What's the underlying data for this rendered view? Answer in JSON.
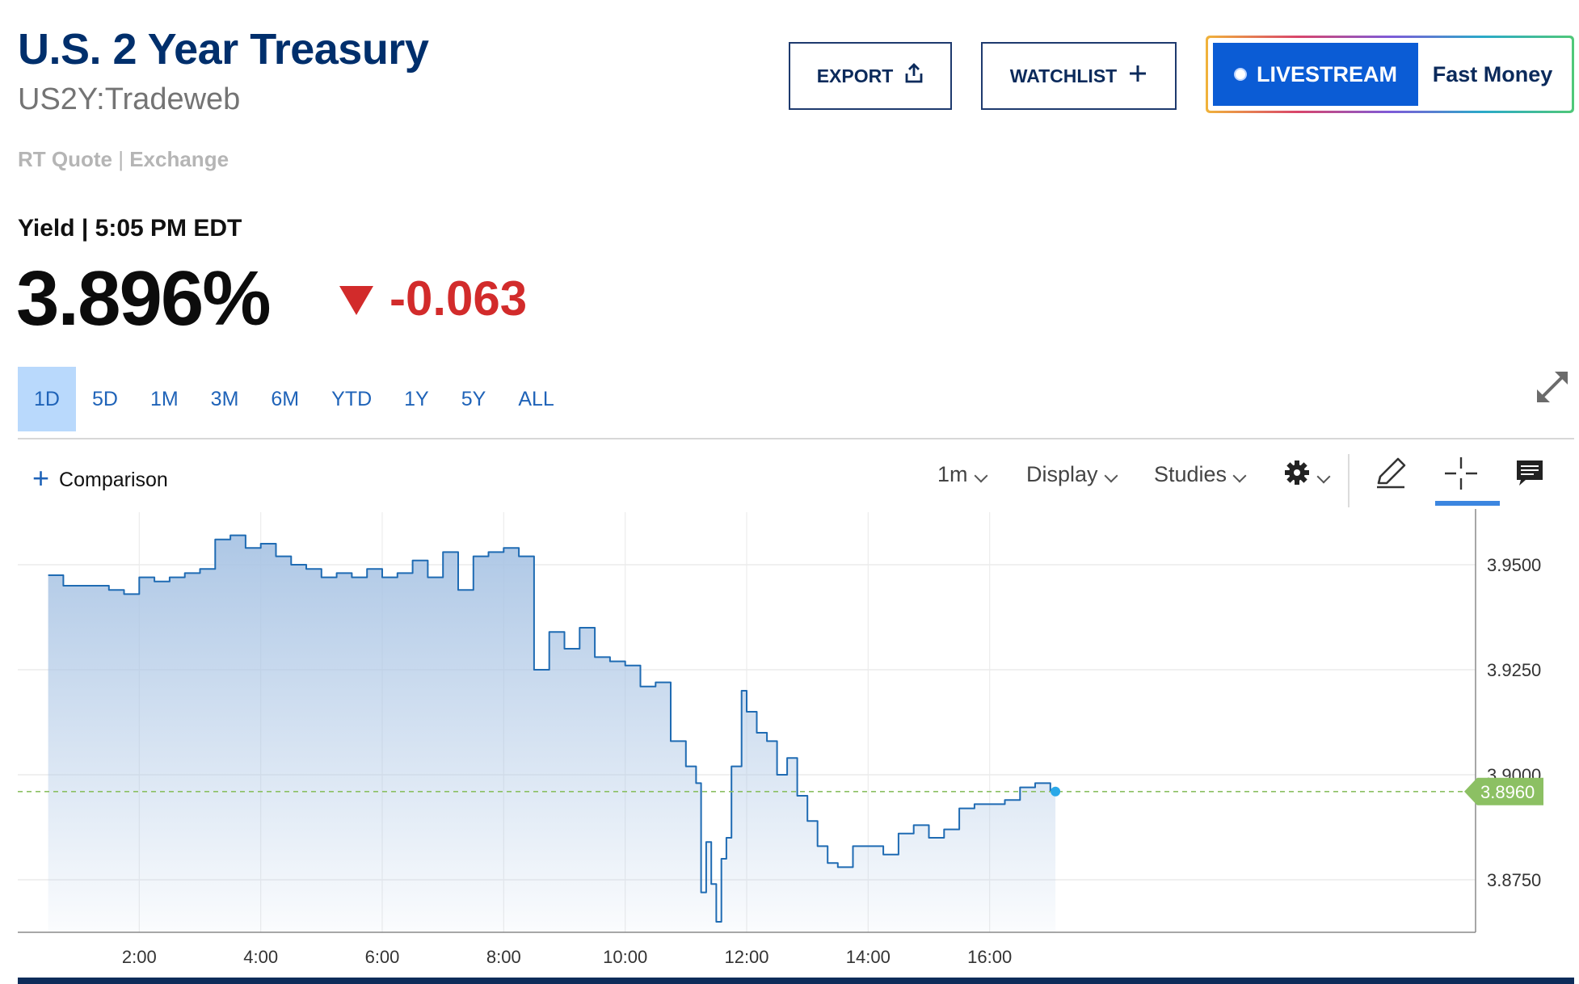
{
  "header": {
    "title": "U.S. 2 Year Treasury",
    "symbol": "US2Y:Tradeweb",
    "quote_type": "RT Quote",
    "quote_sep": " | ",
    "quote_source": "Exchange",
    "yield_label": "Yield | 5:05 PM EDT",
    "price": "3.896%",
    "change": "-0.063",
    "change_direction": "down",
    "change_color": "#d22b2b"
  },
  "buttons": {
    "export": "EXPORT",
    "watchlist": "WATCHLIST",
    "livestream": "LIVESTREAM",
    "fast_money": "Fast Money"
  },
  "ranges": [
    "1D",
    "5D",
    "1M",
    "3M",
    "6M",
    "YTD",
    "1Y",
    "5Y",
    "ALL"
  ],
  "active_range": "1D",
  "toolbar": {
    "comparison": "Comparison",
    "interval": "1m",
    "display": "Display",
    "studies": "Studies"
  },
  "icons": [
    "share-icon",
    "plus-icon",
    "live-dot-icon",
    "expand-icon",
    "gear-icon",
    "pencil-icon",
    "crosshair-icon",
    "comment-icon"
  ],
  "chart_data": {
    "type": "area",
    "series": [
      {
        "x": [
          "00:30",
          "00:45",
          "01:00",
          "01:15",
          "01:30",
          "01:45",
          "02:00",
          "02:15",
          "02:30",
          "02:45",
          "03:00",
          "03:15",
          "03:30",
          "03:45",
          "04:00",
          "04:15",
          "04:30",
          "04:45",
          "05:00",
          "05:15",
          "05:30",
          "05:45",
          "06:00",
          "06:15",
          "06:30",
          "06:45",
          "07:00",
          "07:15",
          "07:30",
          "07:45",
          "08:00",
          "08:15",
          "08:30",
          "08:45",
          "09:00",
          "09:15",
          "09:30",
          "09:45",
          "10:00",
          "10:15",
          "10:30",
          "10:45",
          "11:00",
          "11:10",
          "11:15",
          "11:20",
          "11:25",
          "11:30",
          "11:35",
          "11:40",
          "11:45",
          "11:55",
          "12:00",
          "12:10",
          "12:20",
          "12:30",
          "12:40",
          "12:50",
          "13:00",
          "13:10",
          "13:20",
          "13:30",
          "13:45",
          "14:00",
          "14:15",
          "14:30",
          "14:45",
          "15:00",
          "15:15",
          "15:30",
          "15:45",
          "16:00",
          "16:15",
          "16:30",
          "16:45",
          "17:00",
          "17:05"
        ],
        "values": [
          3.9475,
          3.945,
          3.945,
          3.945,
          3.944,
          3.943,
          3.947,
          3.946,
          3.947,
          3.948,
          3.949,
          3.956,
          3.957,
          3.954,
          3.955,
          3.952,
          3.95,
          3.949,
          3.947,
          3.948,
          3.947,
          3.949,
          3.947,
          3.948,
          3.951,
          3.947,
          3.953,
          3.944,
          3.952,
          3.953,
          3.954,
          3.952,
          3.925,
          3.934,
          3.93,
          3.935,
          3.928,
          3.927,
          3.926,
          3.921,
          3.922,
          3.908,
          3.902,
          3.898,
          3.872,
          3.884,
          3.874,
          3.865,
          3.88,
          3.885,
          3.902,
          3.92,
          3.915,
          3.91,
          3.908,
          3.9,
          3.904,
          3.895,
          3.889,
          3.883,
          3.879,
          3.878,
          3.883,
          3.883,
          3.881,
          3.886,
          3.888,
          3.885,
          3.887,
          3.892,
          3.893,
          3.893,
          3.894,
          3.897,
          3.898,
          3.896,
          3.896
        ]
      }
    ],
    "x_ticks": [
      "2:00",
      "4:00",
      "6:00",
      "8:00",
      "10:00",
      "12:00",
      "14:00",
      "16:00"
    ],
    "y_ticks": [
      "3.8750",
      "3.9000",
      "3.9250",
      "3.9500"
    ],
    "ylim": [
      3.8625,
      3.9625
    ],
    "xlim": [
      "00:00",
      "24:00"
    ],
    "last_value_label": "3.8960",
    "last_value": 3.896,
    "grid": true,
    "line_color": "#1f6bb3",
    "fill_color": "#a9c4e4",
    "last_value_color": "#8cc063"
  }
}
